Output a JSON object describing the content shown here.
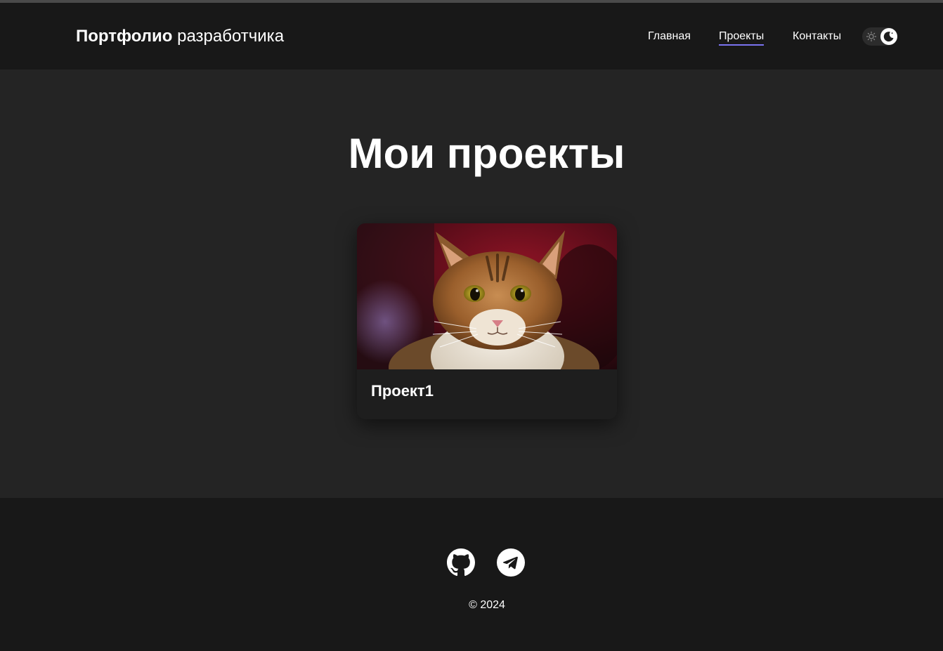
{
  "header": {
    "logo_bold": "Портфолио",
    "logo_normal": " разработчика",
    "nav": {
      "home": "Главная",
      "projects": "Проекты",
      "contacts": "Контакты",
      "active": "projects"
    },
    "theme": {
      "mode": "dark",
      "icons": [
        "sun-icon",
        "moon-icon"
      ]
    }
  },
  "main": {
    "title": "Мои проекты",
    "projects": [
      {
        "title": "Проект1",
        "image": "cat-photo"
      }
    ]
  },
  "footer": {
    "social": [
      "github-icon",
      "telegram-icon"
    ],
    "copyright": "© 2024"
  },
  "colors": {
    "background": "#242424",
    "header_footer": "#181818",
    "card": "#1e1e1e",
    "accent": "#7a73f0",
    "text": "#ffffff"
  }
}
